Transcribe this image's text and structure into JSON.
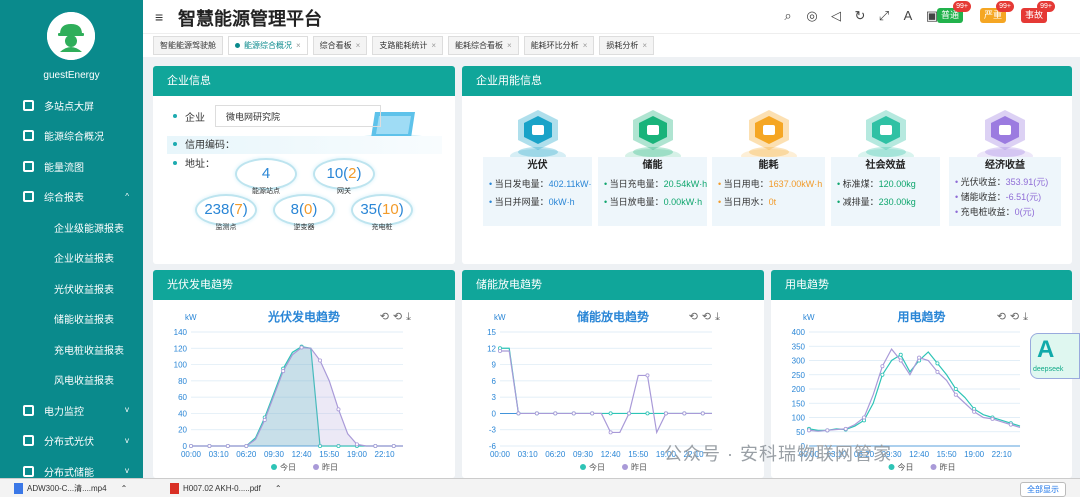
{
  "app": {
    "title": "智慧能源管理平台",
    "username": "guestEnergy",
    "accent": "#0a8a8c",
    "header_color": "#10a69a"
  },
  "header": {
    "icons": [
      "search-icon",
      "help-icon",
      "volume-icon",
      "refresh-icon",
      "fullscreen-icon",
      "font-size-icon",
      "theme-icon"
    ],
    "badges": [
      {
        "label": "普通",
        "count": "99+",
        "color": "#22b24c"
      },
      {
        "label": "严重",
        "count": "99+",
        "color": "#f5a623"
      },
      {
        "label": "事故",
        "count": "99+",
        "color": "#e53935"
      }
    ]
  },
  "sidebar": {
    "items": [
      {
        "label": "多站点大屏",
        "icon": "screen-icon"
      },
      {
        "label": "能源综合概况",
        "icon": "grid-icon"
      },
      {
        "label": "能量流图",
        "icon": "flow-icon"
      },
      {
        "label": "综合报表",
        "icon": "report-icon",
        "chevron": "^"
      },
      {
        "label": "企业级能源报表",
        "sub": true
      },
      {
        "label": "企业收益报表",
        "sub": true
      },
      {
        "label": "光伏收益报表",
        "sub": true
      },
      {
        "label": "储能收益报表",
        "sub": true
      },
      {
        "label": "充电桩收益报表",
        "sub": true
      },
      {
        "label": "风电收益报表",
        "sub": true
      },
      {
        "label": "电力监控",
        "icon": "monitor-icon",
        "chevron": "v"
      },
      {
        "label": "分布式光伏",
        "icon": "solar-icon",
        "chevron": "v"
      },
      {
        "label": "分布式储能",
        "icon": "battery-icon",
        "chevron": "v"
      }
    ]
  },
  "tabs": [
    {
      "label": "智能能源驾驶舱",
      "close": ""
    },
    {
      "label": "能源综合概况",
      "close": "×",
      "active": true
    },
    {
      "label": "综合看板",
      "close": "×"
    },
    {
      "label": "支路能耗统计",
      "close": "×"
    },
    {
      "label": "能耗综合看板",
      "close": "×"
    },
    {
      "label": "能耗环比分析",
      "close": "×"
    },
    {
      "label": "损耗分析",
      "close": "×"
    }
  ],
  "company_panel": {
    "title": "企业信息",
    "company_label": "企业",
    "company_value": "微电网研究院",
    "credit_label": "信用编码：",
    "address_label": "地址：",
    "stats": [
      {
        "main": "4",
        "extra": "",
        "label": "能源站点"
      },
      {
        "main": "10",
        "extra": "2",
        "label": "网关"
      },
      {
        "main": "238",
        "extra": "7",
        "label": "监测点"
      },
      {
        "main": "8",
        "extra": "0",
        "label": "逆变器"
      },
      {
        "main": "35",
        "extra": "10",
        "label": "充电桩"
      }
    ]
  },
  "energy_panel": {
    "title": "企业用能信息",
    "categories": [
      {
        "name": "光伏",
        "color": "#2a86d6",
        "icon_color": "#1aa3c8",
        "lines": [
          {
            "k": "当日发电量：",
            "v": "402.11kW·h"
          },
          {
            "k": "当日并网量：",
            "v": "0kW·h"
          }
        ]
      },
      {
        "name": "储能",
        "color": "#10a66e",
        "icon_color": "#19b37a",
        "lines": [
          {
            "k": "当日充电量：",
            "v": "20.54kW·h"
          },
          {
            "k": "当日放电量：",
            "v": "0.00kW·h"
          }
        ]
      },
      {
        "name": "能耗",
        "color": "#f29b2a",
        "icon_color": "#f5a623",
        "lines": [
          {
            "k": "当日用电：",
            "v": "1637.00kW·h"
          },
          {
            "k": "当日用水：",
            "v": "0t"
          }
        ]
      },
      {
        "name": "社会效益",
        "color": "#10a66e",
        "icon_color": "#2fc1a4",
        "lines": [
          {
            "k": "标准煤：",
            "v": "120.00kg"
          },
          {
            "k": "减排量：",
            "v": "230.00kg"
          }
        ]
      },
      {
        "name": "经济收益",
        "color": "#8e6bd6",
        "icon_color": "#9b7be0",
        "lines": [
          {
            "k": "光伏收益：",
            "v": "353.91(元)"
          },
          {
            "k": "储能收益：",
            "v": "-6.51(元)"
          },
          {
            "k": "充电桩收益：",
            "v": "0(元)"
          }
        ]
      }
    ]
  },
  "chart_panels": [
    {
      "header": "光伏发电趋势"
    },
    {
      "header": "储能放电趋势"
    },
    {
      "header": "用电趋势"
    }
  ],
  "chart_data": [
    {
      "type": "area",
      "title": "光伏发电趋势",
      "ylabel": "kW",
      "ylim": [
        0,
        140
      ],
      "yticks": [
        0,
        20,
        40,
        60,
        80,
        100,
        120,
        140
      ],
      "xticks": [
        "00:00",
        "03:10",
        "06:20",
        "09:30",
        "12:40",
        "15:50",
        "19:00",
        "22:10"
      ],
      "x": [
        "00:00",
        "01:00",
        "02:00",
        "03:00",
        "04:00",
        "05:00",
        "06:00",
        "07:00",
        "08:00",
        "09:00",
        "10:00",
        "11:00",
        "12:00",
        "13:00",
        "14:00",
        "15:00",
        "16:00",
        "17:00",
        "18:00",
        "19:00",
        "20:00",
        "21:00",
        "22:00",
        "23:00"
      ],
      "series": [
        {
          "name": "今日",
          "color": "#2ec4b6",
          "values": [
            0,
            0,
            0,
            0,
            0,
            0,
            0,
            10,
            35,
            65,
            95,
            115,
            122,
            120,
            0,
            0,
            0,
            0,
            0,
            0,
            0,
            0,
            0,
            0
          ]
        },
        {
          "name": "昨日",
          "color": "#a99ad8",
          "values": [
            0,
            0,
            0,
            0,
            0,
            0,
            0,
            8,
            32,
            62,
            92,
            112,
            121,
            120,
            105,
            80,
            45,
            15,
            2,
            0,
            0,
            0,
            0,
            0
          ]
        }
      ],
      "legend": "bottom"
    },
    {
      "type": "line",
      "title": "储能放电趋势",
      "ylabel": "kW",
      "ylim": [
        -6,
        15
      ],
      "yticks": [
        -6,
        -3,
        0,
        3,
        6,
        9,
        12,
        15
      ],
      "xticks": [
        "00:00",
        "03:10",
        "06:20",
        "09:30",
        "12:40",
        "15:50",
        "19:00",
        "22:10"
      ],
      "x": [
        "00:00",
        "01:00",
        "02:00",
        "03:00",
        "04:00",
        "05:00",
        "06:00",
        "07:00",
        "08:00",
        "09:00",
        "10:00",
        "11:00",
        "12:00",
        "13:00",
        "14:00",
        "15:00",
        "16:00",
        "17:00",
        "18:00",
        "19:00",
        "20:00",
        "21:00",
        "22:00",
        "23:00"
      ],
      "series": [
        {
          "name": "今日",
          "color": "#2ec4b6",
          "values": [
            12,
            12,
            0,
            0,
            0,
            0,
            0,
            0,
            0,
            0,
            0,
            0,
            0,
            0,
            0,
            0,
            0,
            0,
            0,
            0,
            0,
            0,
            0,
            0
          ]
        },
        {
          "name": "昨日",
          "color": "#a99ad8",
          "values": [
            11.5,
            11.5,
            0,
            0,
            0,
            0,
            0,
            0,
            0,
            0,
            0,
            0,
            -3.5,
            -3.5,
            0,
            7,
            7,
            -3.5,
            0,
            0,
            0,
            0,
            0,
            0
          ]
        }
      ],
      "legend": "bottom"
    },
    {
      "type": "line",
      "title": "用电趋势",
      "ylabel": "kW",
      "ylim": [
        0,
        400
      ],
      "yticks": [
        0,
        50,
        100,
        150,
        200,
        250,
        300,
        350,
        400
      ],
      "xticks": [
        "00:00",
        "03:10",
        "06:20",
        "09:30",
        "12:40",
        "15:50",
        "19:00",
        "22:10"
      ],
      "x": [
        "00:00",
        "01:00",
        "02:00",
        "03:00",
        "04:00",
        "05:00",
        "06:00",
        "07:00",
        "08:00",
        "09:00",
        "10:00",
        "11:00",
        "12:00",
        "13:00",
        "14:00",
        "15:00",
        "16:00",
        "17:00",
        "18:00",
        "19:00",
        "20:00",
        "21:00",
        "22:00",
        "23:00"
      ],
      "series": [
        {
          "name": "今日",
          "color": "#2ec4b6",
          "values": [
            60,
            55,
            55,
            60,
            58,
            70,
            90,
            150,
            250,
            300,
            320,
            260,
            300,
            330,
            290,
            250,
            200,
            170,
            130,
            110,
            100,
            90,
            80,
            70
          ]
        },
        {
          "name": "昨日",
          "color": "#a99ad8",
          "values": [
            55,
            52,
            55,
            58,
            60,
            75,
            100,
            180,
            280,
            340,
            300,
            250,
            310,
            300,
            260,
            230,
            180,
            150,
            120,
            100,
            95,
            85,
            75,
            65
          ]
        }
      ],
      "legend": "bottom"
    }
  ],
  "downloads": [
    {
      "name": "ADW300-C...清....mp4",
      "icon": "video-file-icon"
    },
    {
      "name": "H007.02 AKH-0.....pdf",
      "icon": "pdf-file-icon"
    }
  ],
  "download_show_all": "全部显示",
  "watermark": "公众号 · 安科瑞物联网管家",
  "assistant": {
    "letter": "A",
    "label": "deepseek"
  }
}
